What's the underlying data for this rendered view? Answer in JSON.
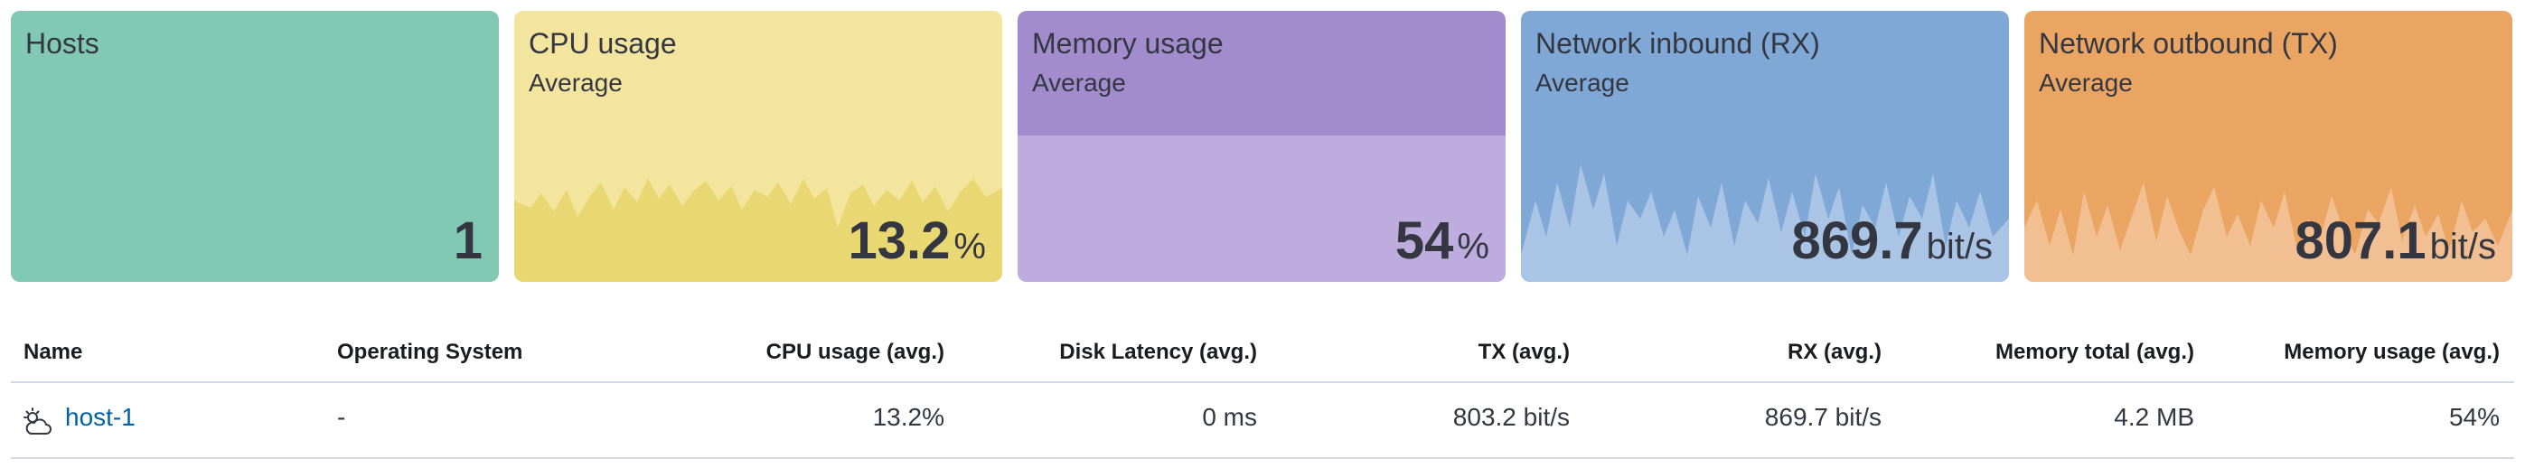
{
  "cards": [
    {
      "title": "Hosts",
      "subtitle": "",
      "value": "1",
      "unit": "",
      "color": "#82c9b3",
      "chart_color": ""
    },
    {
      "title": "CPU usage",
      "subtitle": "Average",
      "value": "13.2",
      "unit": "%",
      "color": "#f3e49e",
      "chart_color": "#e9d772"
    },
    {
      "title": "Memory usage",
      "subtitle": "Average",
      "value": "54",
      "unit": "%",
      "color": "#a38ccd",
      "chart_color": "#bdacdd",
      "fill_fraction": 0.54
    },
    {
      "title": "Network inbound (RX)",
      "subtitle": "Average",
      "value": "869.7",
      "unit": "bit/s",
      "color": "#7fa8d6",
      "chart_color": "#a9c4e4"
    },
    {
      "title": "Network outbound (TX)",
      "subtitle": "Average",
      "value": "807.1",
      "unit": "bit/s",
      "color": "#eaa563",
      "chart_color": "#f1bf91"
    }
  ],
  "table": {
    "columns": [
      "Name",
      "Operating System",
      "CPU usage (avg.)",
      "Disk Latency (avg.)",
      "TX (avg.)",
      "RX (avg.)",
      "Memory total (avg.)",
      "Memory usage (avg.)"
    ],
    "rows": [
      {
        "icon": "cloud-sun-icon",
        "name": "host-1",
        "os": "-",
        "cpu": "13.2%",
        "disk_latency": "0 ms",
        "tx": "803.2 bit/s",
        "rx": "869.7 bit/s",
        "memory_total": "4.2 MB",
        "memory_usage": "54%"
      }
    ]
  },
  "colors": {
    "link": "#0061a6",
    "divider": "#d3dae6"
  }
}
